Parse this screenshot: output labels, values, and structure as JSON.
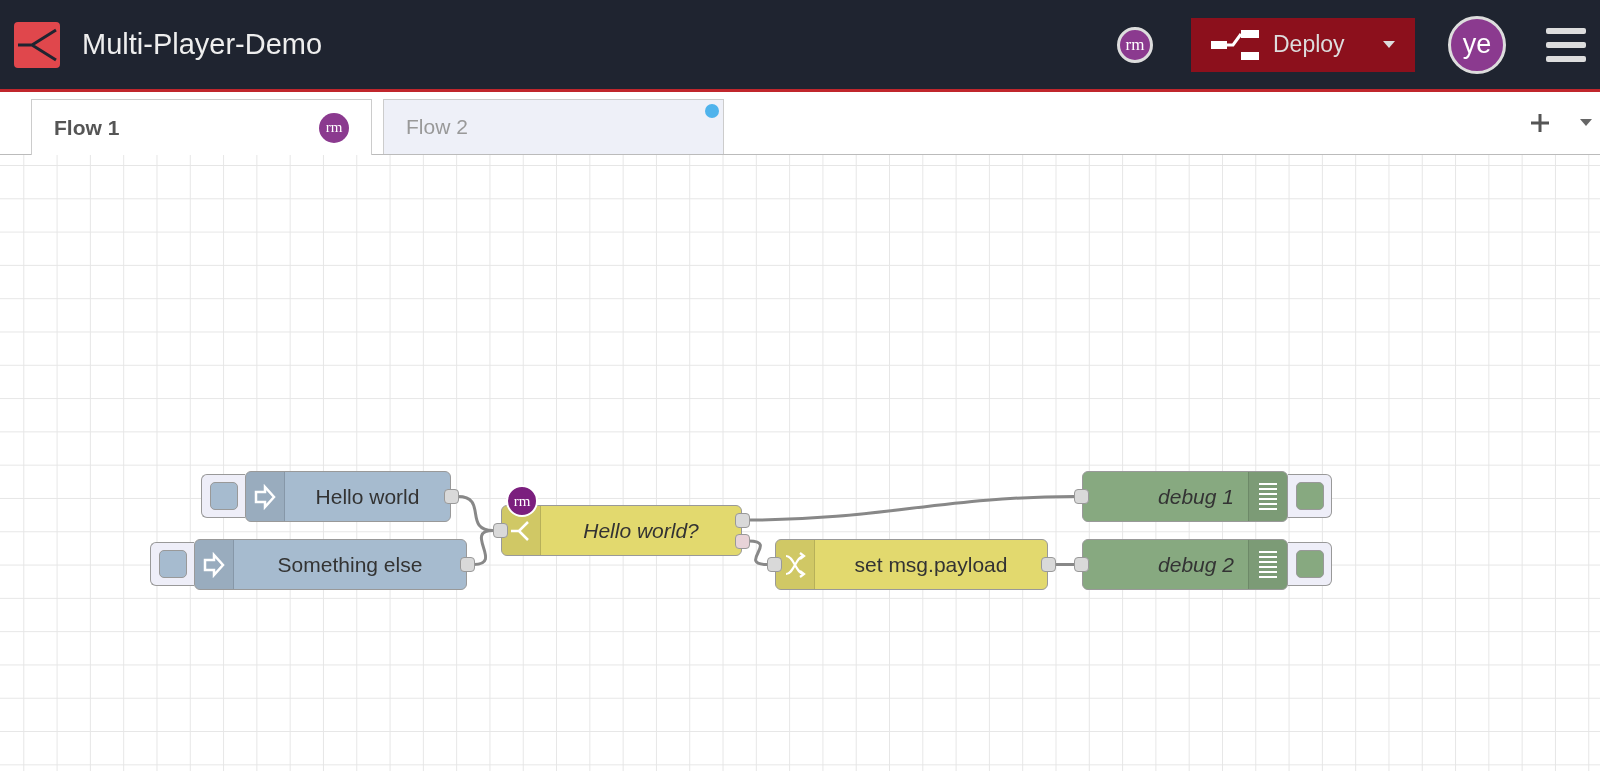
{
  "header": {
    "title": "Multi-Player-Demo",
    "users": [
      "rm"
    ],
    "deploy": {
      "label": "Deploy"
    },
    "avatar": "ye"
  },
  "tabs": [
    {
      "label": "Flow 1",
      "selected": true,
      "badge": "rm",
      "changed": false
    },
    {
      "label": "Flow 2",
      "selected": false,
      "changed": true
    }
  ],
  "nodes": [
    {
      "kind": "inject",
      "label": "Hello world",
      "italic": false
    },
    {
      "kind": "inject",
      "label": "Something else",
      "italic": false
    },
    {
      "kind": "switch",
      "label": "Hello world?",
      "italic": true,
      "badge": "rm"
    },
    {
      "kind": "change",
      "label": "set msg.payload",
      "italic": false
    },
    {
      "kind": "debug",
      "label": "debug 1",
      "italic": true,
      "active": true
    },
    {
      "kind": "debug",
      "label": "debug 2",
      "italic": true,
      "active": true
    }
  ]
}
